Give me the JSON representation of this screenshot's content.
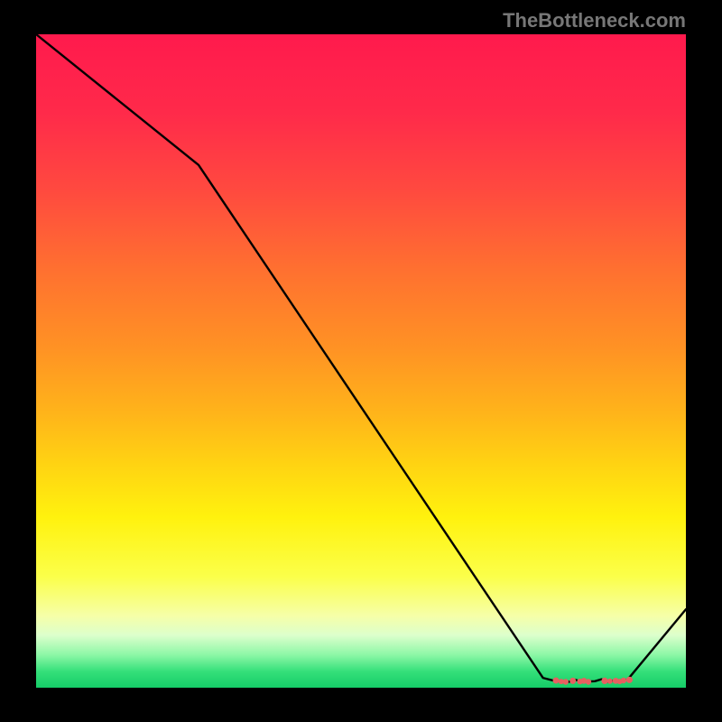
{
  "attribution": "TheBottleneck.com",
  "chart_data": {
    "type": "line",
    "title": "",
    "xlabel": "",
    "ylabel": "",
    "xlim": [
      0,
      100
    ],
    "ylim": [
      0,
      100
    ],
    "x": [
      0,
      25,
      78,
      80,
      82,
      83,
      84,
      86,
      87,
      88,
      89,
      91,
      100
    ],
    "values": [
      100,
      80,
      1.5,
      1,
      0.9,
      1.2,
      0.9,
      1,
      1.3,
      0.9,
      1.1,
      1.2,
      12
    ],
    "markers": {
      "x": [
        80.0,
        80.8,
        81.5,
        82.6,
        83.7,
        84.3,
        85.0,
        87.5,
        88.3,
        89.2,
        89.8,
        90.4,
        91.3
      ],
      "y": [
        1.1,
        0.95,
        0.9,
        1.05,
        0.95,
        1.05,
        0.9,
        1.05,
        1.0,
        1.05,
        0.95,
        1.1,
        1.2
      ],
      "r": [
        3.5,
        3.0,
        3.2,
        3.5,
        3.2,
        3.4,
        3.2,
        3.6,
        3.0,
        3.4,
        3.0,
        3.2,
        3.6
      ],
      "color": "#e66060"
    },
    "line_color": "#000000",
    "line_width": 2.4
  }
}
